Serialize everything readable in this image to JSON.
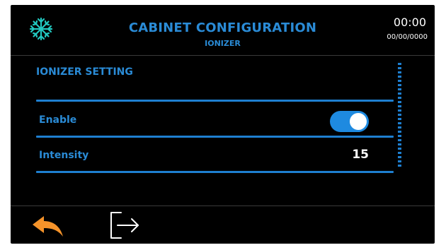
{
  "header": {
    "title": "CABINET CONFIGURATION",
    "subtitle": "IONIZER",
    "time": "00:00",
    "date": "00/00/0000",
    "icon": "snowflake-icon"
  },
  "settings": {
    "section_title": "IONIZER SETTING",
    "rows": [
      {
        "label": "Enable",
        "control": "toggle",
        "enabled": true
      },
      {
        "label": "Intensity",
        "value": "15"
      }
    ]
  },
  "footer": {
    "back_icon": "back-arrow-icon",
    "exit_icon": "exit-icon"
  },
  "colors": {
    "accent": "#2a8bd6",
    "toggle_on": "#1e8ae0",
    "back_arrow": "#f5932a",
    "background": "#000000"
  }
}
